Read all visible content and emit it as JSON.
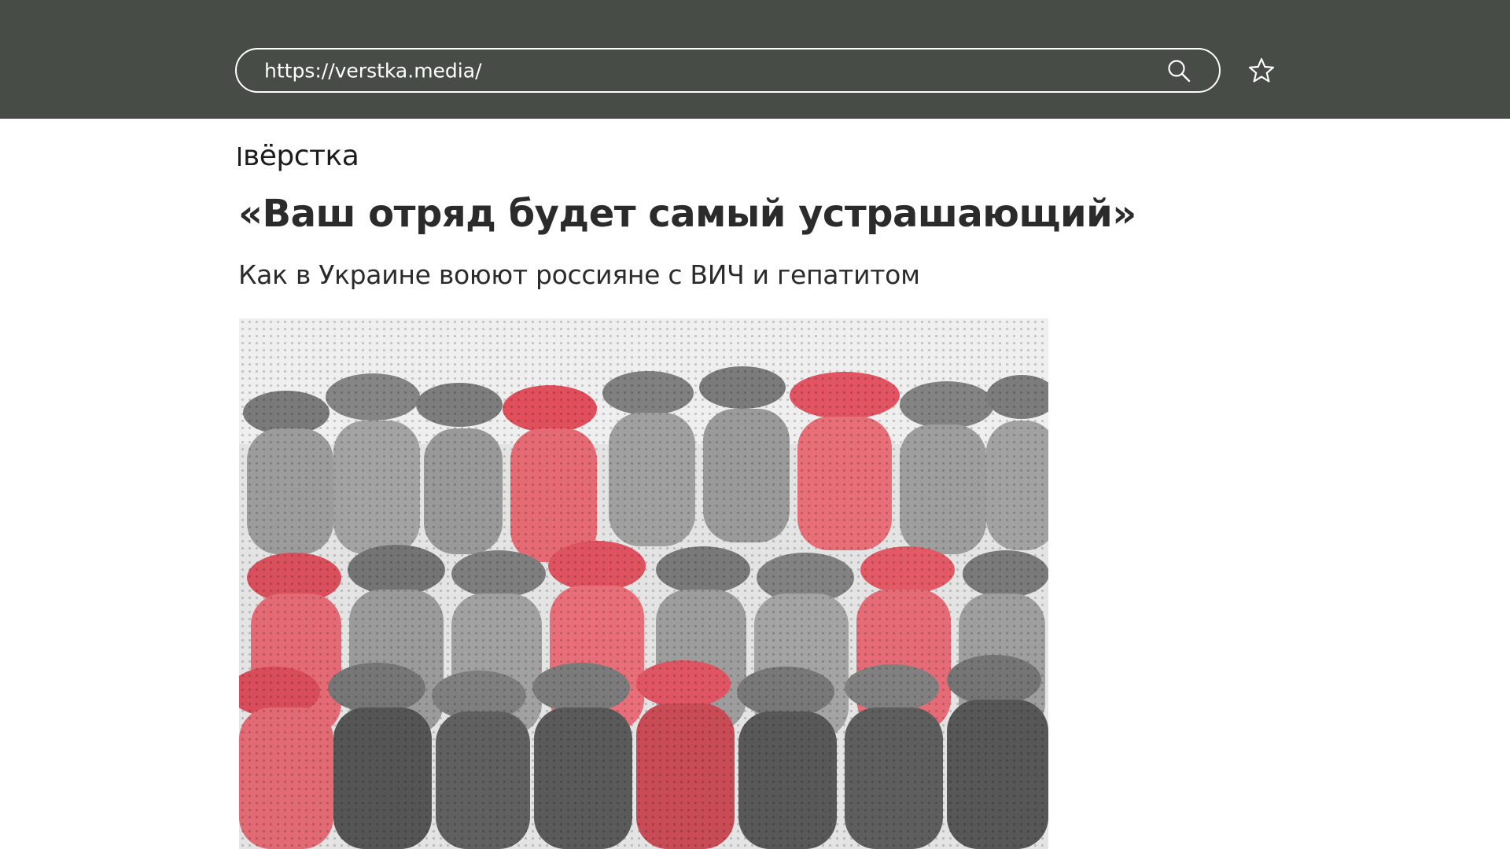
{
  "browser": {
    "url": "https://verstka.media/"
  },
  "site": {
    "logo_text": "вёрстка"
  },
  "article": {
    "headline": "«Ваш отряд будет самый устрашающий»",
    "subheadline": "Как в Украине воюют россияне с ВИЧ и гепатитом"
  },
  "icons": {
    "search": "search-icon",
    "bookmark": "star-icon"
  },
  "colors": {
    "toolbar_bg": "#484c47",
    "accent_red": "#e8505e",
    "text_dark": "#2b2b2b"
  }
}
